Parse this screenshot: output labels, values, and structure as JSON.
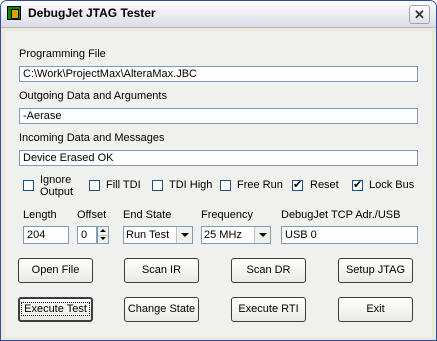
{
  "window": {
    "title": "DebugJet JTAG Tester",
    "close": "✕"
  },
  "programming_file": {
    "label": "Programming File",
    "value": "C:\\Work\\ProjectMax\\AlteraMax.JBC"
  },
  "outgoing": {
    "label": "Outgoing Data and Arguments",
    "value": "-Aerase"
  },
  "incoming": {
    "label": "Incoming Data and Messages",
    "value": "Device Erased OK"
  },
  "options": [
    {
      "label": "Ignore Output",
      "line1": "Ignore",
      "line2": "Output",
      "checked": false
    },
    {
      "label": "Fill TDI",
      "checked": false
    },
    {
      "label": "TDI High",
      "checked": false
    },
    {
      "label": "Free Run",
      "checked": false
    },
    {
      "label": "Reset",
      "checked": true
    },
    {
      "label": "Lock Bus",
      "checked": true
    }
  ],
  "length": {
    "label": "Length",
    "value": "204"
  },
  "offset": {
    "label": "Offset",
    "value": "0"
  },
  "end_state": {
    "label": "End State",
    "value": "Run Test"
  },
  "frequency": {
    "label": "Frequency",
    "value": "25 MHz"
  },
  "tcp": {
    "label": "DebugJet TCP Adr./USB",
    "value": "USB 0"
  },
  "buttons": {
    "open_file": "Open File",
    "scan_ir": "Scan IR",
    "scan_dr": "Scan DR",
    "setup_jtag": "Setup JTAG",
    "execute_test": "Execute Test",
    "change_state": "Change State",
    "execute_rti": "Execute RTI",
    "exit": "Exit"
  }
}
